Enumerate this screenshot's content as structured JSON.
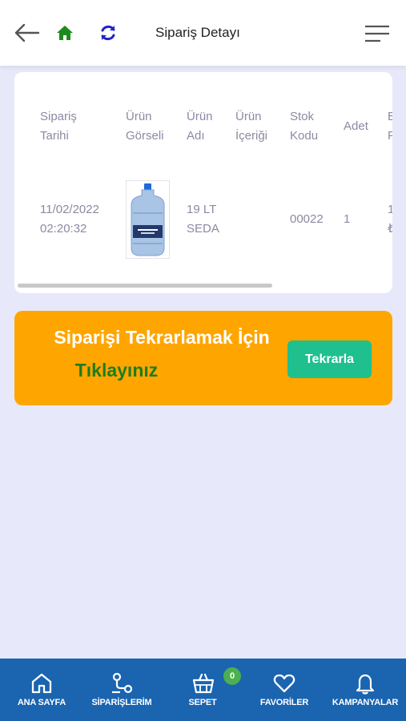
{
  "header": {
    "title": "Sipariş Detayı",
    "icons": [
      "back-arrow-icon",
      "home-icon",
      "refresh-icon",
      "menu-icon"
    ],
    "home_color": "#1e8a1e",
    "refresh_color": "#2222cc"
  },
  "table": {
    "headers": [
      [
        "Sipariş",
        "Tarihi"
      ],
      [
        "Ürün",
        "Görseli"
      ],
      [
        "Ürün",
        "Adı"
      ],
      [
        "Ürün",
        "İçeriği"
      ],
      [
        "Stok",
        "Kodu"
      ],
      [
        "Adet"
      ],
      [
        "B",
        "F"
      ]
    ],
    "row": {
      "date": "11/02/2022",
      "time": "02:20:32",
      "product_name_1": "19 LT",
      "product_name_2": "SEDA",
      "product_content": "",
      "stock_code": "00022",
      "quantity": "1",
      "price_partial_1": "1",
      "price_partial_2": "₺"
    }
  },
  "cta": {
    "line1": "Siparişi Tekrarlamak İçin",
    "line2": "Tıklayınız",
    "button": "Tekrarla",
    "bg_color": "#ffa500",
    "button_color": "#20bf8e"
  },
  "bottom_nav": {
    "items": [
      {
        "label": "ANA SAYFA",
        "icon": "home-outline-icon"
      },
      {
        "label": "SİPARİŞLERİM",
        "icon": "orders-icon"
      },
      {
        "label": "SEPET",
        "icon": "basket-icon"
      },
      {
        "label": "FAVORİLER",
        "icon": "heart-icon"
      },
      {
        "label": "KAMPANYALAR",
        "icon": "bell-icon"
      }
    ],
    "cart_badge": "0",
    "bg_color": "#1a64b0"
  }
}
